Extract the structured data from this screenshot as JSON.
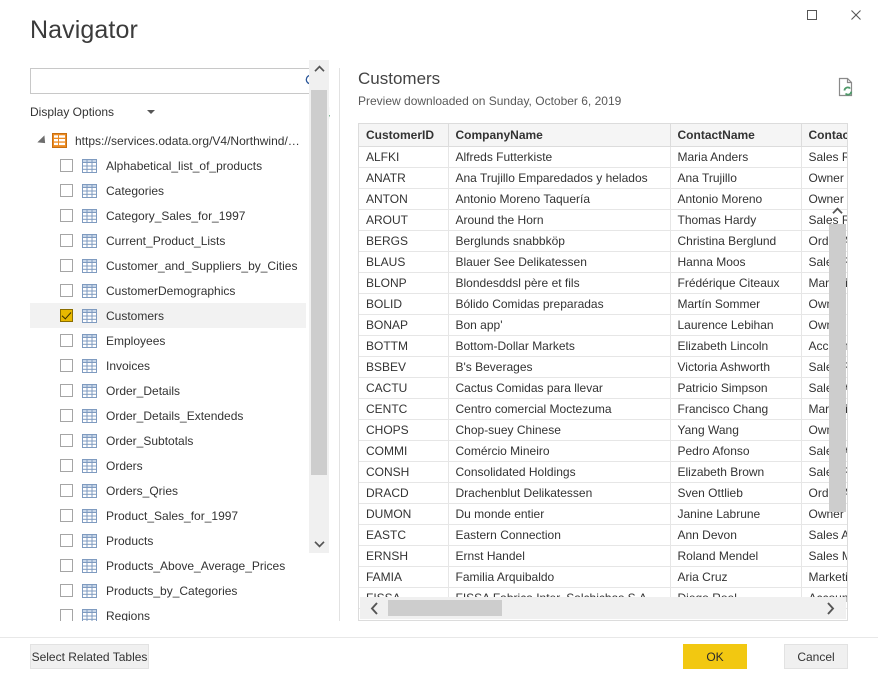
{
  "window": {
    "title": "Navigator",
    "maximize_label": "□",
    "close_label": "×"
  },
  "left": {
    "search": {
      "value": "",
      "placeholder": ""
    },
    "display_options_label": "Display Options",
    "tree": {
      "root": {
        "label": "https://services.odata.org/V4/Northwind/N...",
        "expanded": true
      },
      "items": [
        {
          "label": "Alphabetical_list_of_products",
          "checked": false,
          "selected": false
        },
        {
          "label": "Categories",
          "checked": false,
          "selected": false
        },
        {
          "label": "Category_Sales_for_1997",
          "checked": false,
          "selected": false
        },
        {
          "label": "Current_Product_Lists",
          "checked": false,
          "selected": false
        },
        {
          "label": "Customer_and_Suppliers_by_Cities",
          "checked": false,
          "selected": false
        },
        {
          "label": "CustomerDemographics",
          "checked": false,
          "selected": false
        },
        {
          "label": "Customers",
          "checked": true,
          "selected": true
        },
        {
          "label": "Employees",
          "checked": false,
          "selected": false
        },
        {
          "label": "Invoices",
          "checked": false,
          "selected": false
        },
        {
          "label": "Order_Details",
          "checked": false,
          "selected": false
        },
        {
          "label": "Order_Details_Extendeds",
          "checked": false,
          "selected": false
        },
        {
          "label": "Order_Subtotals",
          "checked": false,
          "selected": false
        },
        {
          "label": "Orders",
          "checked": false,
          "selected": false
        },
        {
          "label": "Orders_Qries",
          "checked": false,
          "selected": false
        },
        {
          "label": "Product_Sales_for_1997",
          "checked": false,
          "selected": false
        },
        {
          "label": "Products",
          "checked": false,
          "selected": false
        },
        {
          "label": "Products_Above_Average_Prices",
          "checked": false,
          "selected": false
        },
        {
          "label": "Products_by_Categories",
          "checked": false,
          "selected": false
        },
        {
          "label": "Regions",
          "checked": false,
          "selected": false
        }
      ]
    }
  },
  "right": {
    "preview_title": "Customers",
    "preview_subtitle": "Preview downloaded on Sunday, October 6, 2019",
    "table": {
      "columns": [
        "CustomerID",
        "CompanyName",
        "ContactName",
        "ContactTitle"
      ],
      "rows": [
        [
          "ALFKI",
          "Alfreds Futterkiste",
          "Maria Anders",
          "Sales Representative"
        ],
        [
          "ANATR",
          "Ana Trujillo Emparedados y helados",
          "Ana Trujillo",
          "Owner"
        ],
        [
          "ANTON",
          "Antonio Moreno Taquería",
          "Antonio Moreno",
          "Owner"
        ],
        [
          "AROUT",
          "Around the Horn",
          "Thomas Hardy",
          "Sales Representative"
        ],
        [
          "BERGS",
          "Berglunds snabbköp",
          "Christina Berglund",
          "Order Administrator"
        ],
        [
          "BLAUS",
          "Blauer See Delikatessen",
          "Hanna Moos",
          "Sales Representative"
        ],
        [
          "BLONP",
          "Blondesddsl père et fils",
          "Frédérique Citeaux",
          "Marketing Manager"
        ],
        [
          "BOLID",
          "Bólido Comidas preparadas",
          "Martín Sommer",
          "Owner"
        ],
        [
          "BONAP",
          "Bon app'",
          "Laurence Lebihan",
          "Owner"
        ],
        [
          "BOTTM",
          "Bottom-Dollar Markets",
          "Elizabeth Lincoln",
          "Accounting Manager"
        ],
        [
          "BSBEV",
          "B's Beverages",
          "Victoria Ashworth",
          "Sales Representative"
        ],
        [
          "CACTU",
          "Cactus Comidas para llevar",
          "Patricio Simpson",
          "Sales Agent"
        ],
        [
          "CENTC",
          "Centro comercial Moctezuma",
          "Francisco Chang",
          "Marketing Manager"
        ],
        [
          "CHOPS",
          "Chop-suey Chinese",
          "Yang Wang",
          "Owner"
        ],
        [
          "COMMI",
          "Comércio Mineiro",
          "Pedro Afonso",
          "Sales Associate"
        ],
        [
          "CONSH",
          "Consolidated Holdings",
          "Elizabeth Brown",
          "Sales Representative"
        ],
        [
          "DRACD",
          "Drachenblut Delikatessen",
          "Sven Ottlieb",
          "Order Administrator"
        ],
        [
          "DUMON",
          "Du monde entier",
          "Janine Labrune",
          "Owner"
        ],
        [
          "EASTC",
          "Eastern Connection",
          "Ann Devon",
          "Sales Agent"
        ],
        [
          "ERNSH",
          "Ernst Handel",
          "Roland Mendel",
          "Sales Manager"
        ],
        [
          "FAMIA",
          "Familia Arquibaldo",
          "Aria Cruz",
          "Marketing Assistant"
        ],
        [
          "FISSA",
          "FISSA Fabrica Inter. Salchichas S.A.",
          "Diego Roel",
          "Accounting Manager"
        ]
      ]
    }
  },
  "footer": {
    "select_related_label": "Select Related Tables",
    "ok_label": "OK",
    "cancel_label": "Cancel"
  },
  "colors": {
    "accent_yellow": "#f2c811",
    "checkbox_checked": "#e8b800",
    "db_icon_orange": "#ec8b22",
    "search_icon_blue": "#2a5699",
    "refresh_green": "#4e9a6a"
  }
}
